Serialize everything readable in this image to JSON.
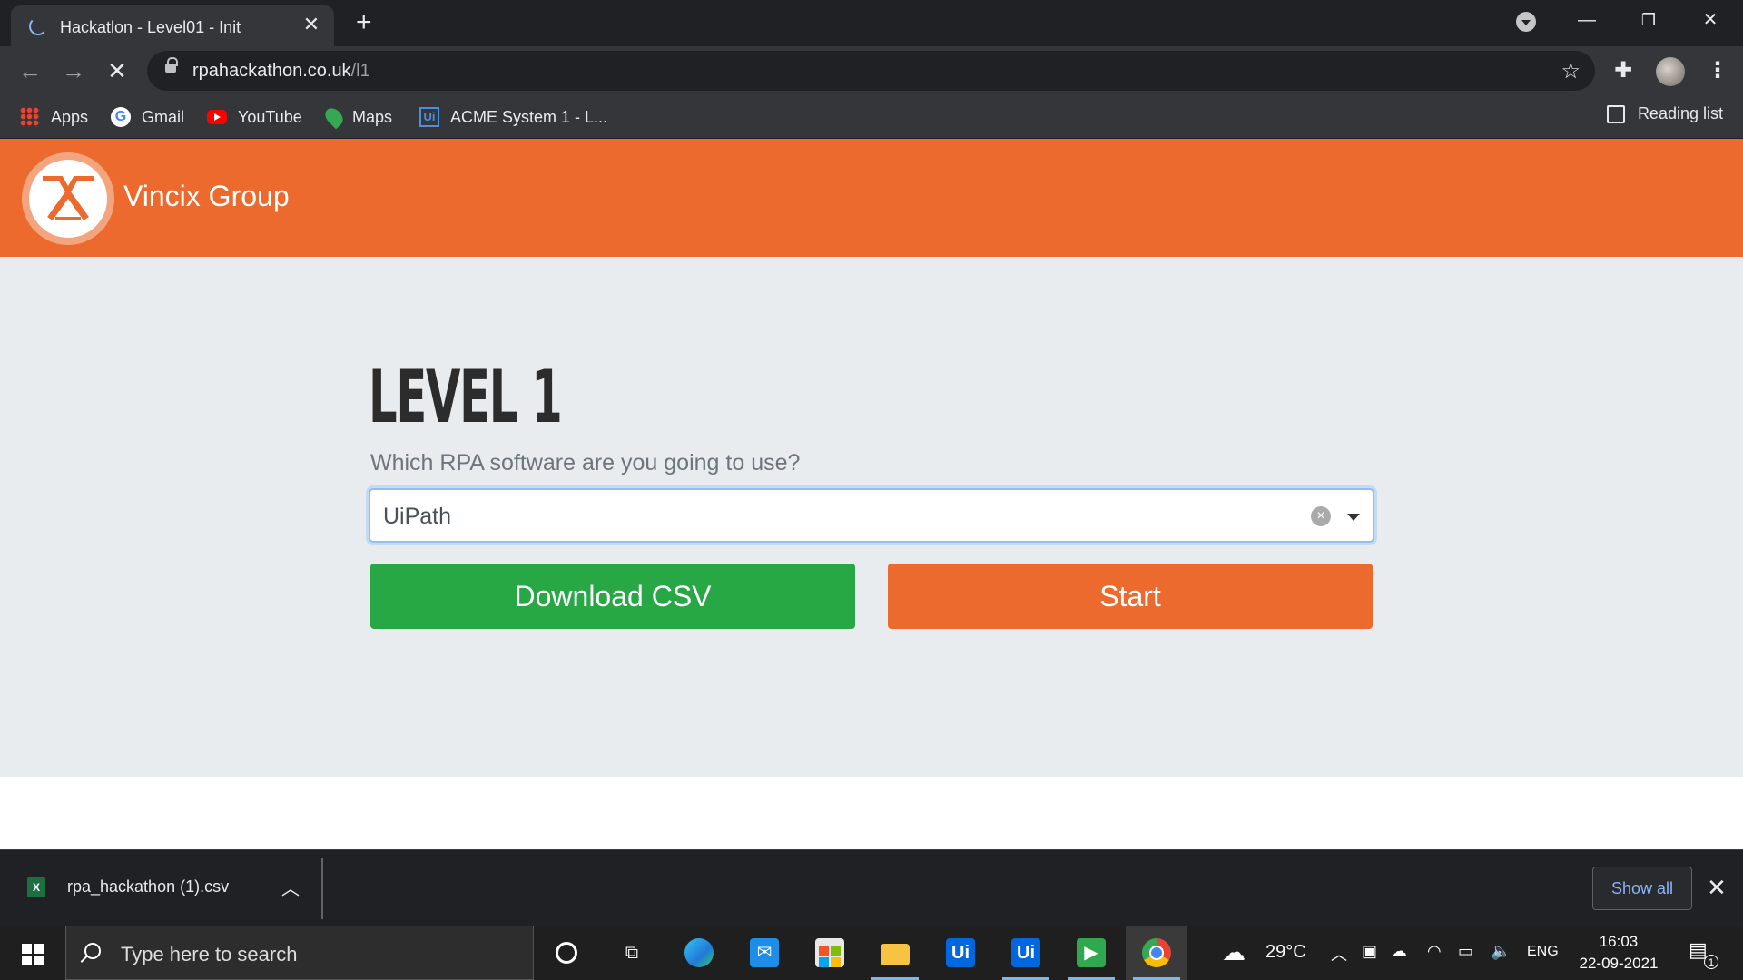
{
  "browser": {
    "tab_title": "Hackatlon - Level01 - Init",
    "url_host": "rpahackathon.co.uk",
    "url_path": "/l1"
  },
  "bookmarks": [
    {
      "label": "Apps",
      "icon": "apps-grid-icon"
    },
    {
      "label": "Gmail",
      "icon": "google-icon"
    },
    {
      "label": "YouTube",
      "icon": "youtube-icon"
    },
    {
      "label": "Maps",
      "icon": "maps-icon"
    },
    {
      "label": "ACME System 1 - L...",
      "icon": "uipath-icon"
    }
  ],
  "reading_list": "Reading list",
  "site": {
    "brand": "Vincix Group",
    "accent_color": "#ec6a2d",
    "level_title": "LEVEL 1",
    "question": "Which RPA software are you going to use?",
    "selected_software": "UiPath",
    "download_button": "Download CSV",
    "start_button": "Start",
    "download_color": "#28a745"
  },
  "download_shelf": {
    "file_name": "rpa_hackathon (1).csv",
    "show_all": "Show all"
  },
  "taskbar": {
    "search_placeholder": "Type here to search",
    "weather": "29°C",
    "language": "ENG",
    "time": "16:03",
    "date": "22-09-2021",
    "notification_count": "1"
  }
}
